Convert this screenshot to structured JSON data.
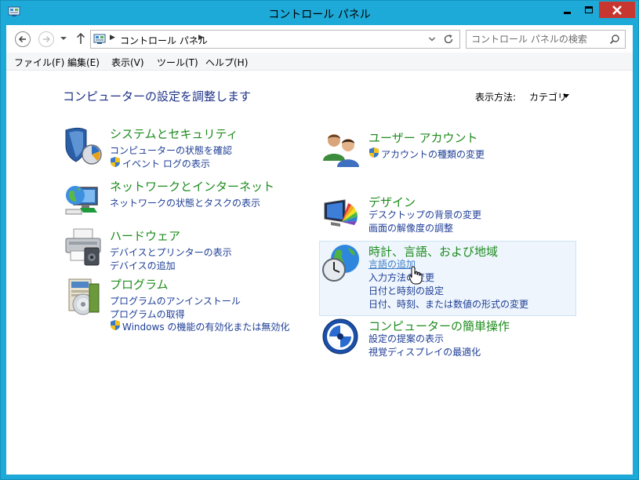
{
  "window": {
    "title": "コントロール パネル"
  },
  "address": {
    "crumb": "コントロール パネル",
    "sep": "▶"
  },
  "search": {
    "placeholder": "コントロール パネルの検索"
  },
  "menu": [
    "ファイル(F)",
    "編集(E)",
    "表示(V)",
    "ツール(T)",
    "ヘルプ(H)"
  ],
  "main": {
    "heading": "コンピューターの設定を調整します",
    "view_by_label": "表示方法:",
    "view_by_value": "カテゴリ"
  },
  "categories": {
    "system": {
      "title": "システムとセキュリティ",
      "links": [
        "コンピューターの状態を確認",
        "イベント ログの表示"
      ]
    },
    "network": {
      "title": "ネットワークとインターネット",
      "links": [
        "ネットワークの状態とタスクの表示"
      ]
    },
    "hardware": {
      "title": "ハードウェア",
      "links": [
        "デバイスとプリンターの表示",
        "デバイスの追加"
      ]
    },
    "programs": {
      "title": "プログラム",
      "links": [
        "プログラムのアンインストール",
        "プログラムの取得",
        "Windows の機能の有効化または無効化"
      ]
    },
    "users": {
      "title": "ユーザー アカウント",
      "links": [
        "アカウントの種類の変更"
      ]
    },
    "design": {
      "title": "デザイン",
      "links": [
        "デスクトップの背景の変更",
        "画面の解像度の調整"
      ]
    },
    "clock": {
      "title": "時計、言語、および地域",
      "links": [
        "言語の追加",
        "入力方法の変更",
        "日付と時刻の設定",
        "日付、時刻、または数値の形式の変更"
      ]
    },
    "ease": {
      "title": "コンピューターの簡単操作",
      "links": [
        "設定の提案の表示",
        "視覚ディスプレイの最適化"
      ]
    }
  },
  "colors": {
    "frame": "#1eaad8",
    "category_title": "#1e8c1e",
    "link": "#1e3e96",
    "heading": "#1e3287",
    "close_button": "#c7372f"
  },
  "icons": [
    "control-panel-icon",
    "back-arrow-icon",
    "forward-arrow-icon",
    "up-arrow-icon",
    "refresh-icon",
    "search-icon",
    "uac-shield-icon",
    "hand-cursor-icon"
  ]
}
